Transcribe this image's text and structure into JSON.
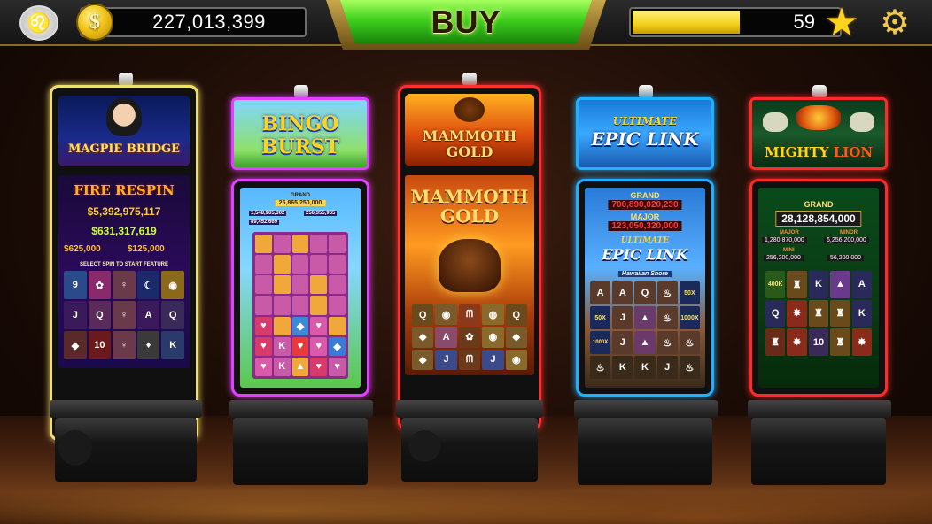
{
  "topbar": {
    "coins": "227,013,399",
    "coin_symbol": "$",
    "buy_label": "BUY",
    "level": "59",
    "xp_progress": 0.52,
    "icons": {
      "avatar": "lion-avatar-icon",
      "coin": "coin-icon",
      "star": "star-icon",
      "settings": "gear-icon"
    }
  },
  "machines": [
    {
      "name": "MAGPIE BRIDGE",
      "frame_color": "#f0e070",
      "feature": "FIRE RESPIN",
      "jackpots": [
        "$5,392,975,117",
        "$631,317,619",
        "$625,000",
        "$125,000"
      ],
      "prompt": "SELECT SPIN TO START FEATURE"
    },
    {
      "name_top": "BINGO",
      "name_bottom": "BURST",
      "frame_color": "#e040ff",
      "grand_label": "GRAND",
      "grand_value": "25,865,250,000",
      "jackpots": [
        "1,548,965,302",
        "256,355,965"
      ],
      "small": "89,452,669"
    },
    {
      "name_top": "MAMMOTH",
      "name_bottom": "GOLD",
      "frame_color": "#ff3030"
    },
    {
      "name_top": "ULTIMATE",
      "name_bottom": "EPIC LINK",
      "frame_color": "#20b0ff",
      "grand_label": "GRAND",
      "grand_value": "700,890,020,230",
      "major_label": "MAJOR",
      "major_value": "123,050,320,000",
      "subtitle": "Hawaiian Shore",
      "multipliers": [
        "50X",
        "50X",
        "1000X",
        "1000X"
      ]
    },
    {
      "name_top": "MIGHTY",
      "name_bottom": "LION",
      "frame_color": "#ff2a2a",
      "grand_label": "GRAND",
      "grand_value": "28,128,854,000",
      "major_label": "MAJOR",
      "major_value": "1,280,870,000",
      "minor_label": "MINOR",
      "minor_value": "6,256,200,000",
      "mini_label": "MINI",
      "mini_value": "256,200,000",
      "mini2_value": "56,200,000",
      "badge": "400K"
    }
  ]
}
